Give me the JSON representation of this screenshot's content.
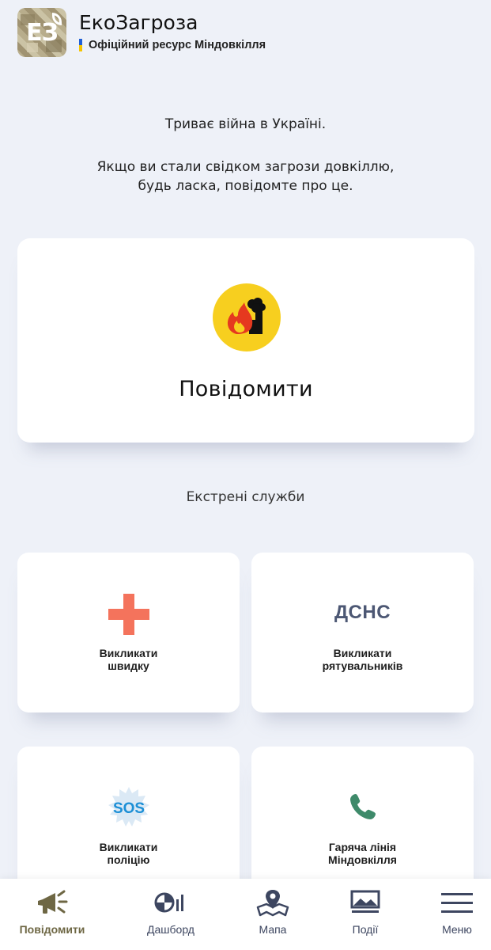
{
  "header": {
    "logo_text": "ЕЗ",
    "app_title": "ЕкоЗагроза",
    "subtitle": "Офіційний ресурс Міндовкілля"
  },
  "intro": {
    "line1": "Триває війна в Україні.",
    "line2a": "Якщо ви стали свідком загрози довкіллю,",
    "line2b": "будь ласка, повідомте про це."
  },
  "report": {
    "label": "Повідомити",
    "icon": "fire-factory-icon"
  },
  "emergency": {
    "title": "Екстрені служби",
    "services": [
      {
        "line1": "Викликати",
        "line2": "швидку",
        "icon": "medical-cross-icon"
      },
      {
        "line1": "Викликати",
        "line2": "рятувальників",
        "icon": "dsns-logo",
        "logo_text": "ДСНС"
      },
      {
        "line1": "Викликати",
        "line2": "поліцію",
        "icon": "sos-icon",
        "logo_text": "SOS"
      },
      {
        "line1": "Гаряча лінія",
        "line2": "Міндовкілля",
        "icon": "phone-icon"
      }
    ]
  },
  "nav": {
    "items": [
      {
        "label": "Повідомити",
        "icon": "megaphone-icon",
        "active": true
      },
      {
        "label": "Дашборд",
        "icon": "dashboard-icon",
        "active": false
      },
      {
        "label": "Мапа",
        "icon": "map-icon",
        "active": false
      },
      {
        "label": "Події",
        "icon": "events-icon",
        "active": false
      },
      {
        "label": "Меню",
        "icon": "menu-icon",
        "active": false
      }
    ]
  },
  "colors": {
    "background": "#eef1f8",
    "accent_yellow": "#f7cf1f",
    "ambulance_red": "#f4735c",
    "dsns_slate": "#4c5773",
    "sos_blue": "#1c8fd6",
    "phone_green": "#3e8a6a",
    "nav_active": "#6e6744",
    "nav_inactive": "#3d4660"
  }
}
